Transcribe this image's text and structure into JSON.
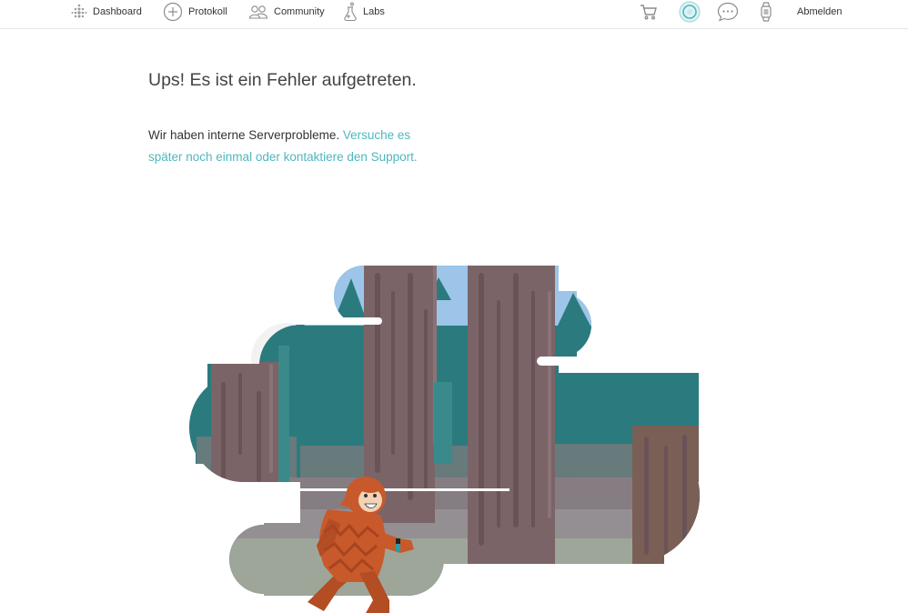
{
  "nav": {
    "dashboard": "Dashboard",
    "protokoll": "Protokoll",
    "community": "Community",
    "labs": "Labs",
    "logout": "Abmelden"
  },
  "icons": {
    "dashboard": "fitbit-dots-icon",
    "protokoll": "plus-circle-icon",
    "community": "people-icon",
    "labs": "flask-icon",
    "cart": "shopping-cart-icon",
    "avatar": "profile-avatar-icon",
    "messages": "speech-bubble-icon",
    "device": "watch-icon"
  },
  "error": {
    "title": "Ups! Es ist ein Fehler aufgetreten.",
    "message_plain": "Wir haben interne Serverprobleme.",
    "message_link": "Versuche es später noch einmal oder kontaktiere den Support."
  },
  "colors": {
    "accent": "#4eb7bd",
    "teal_forest": "#2b7a7d",
    "trunk": "#7b6467",
    "sky": "#9cc5e9",
    "bigfoot": "#c8592a"
  }
}
